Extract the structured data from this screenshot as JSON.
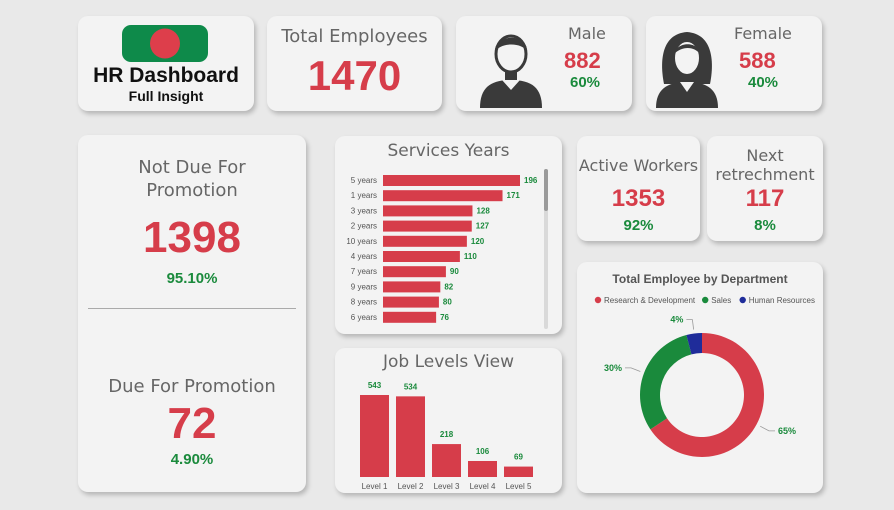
{
  "brand": {
    "title": "HR Dashboard",
    "subtitle": "Full Insight",
    "flag_colors": {
      "field": "#0e8a4a",
      "disc": "#dd3e4b"
    }
  },
  "total_employees": {
    "label": "Total Employees",
    "value": "1470"
  },
  "male": {
    "label": "Male",
    "value": "882",
    "percent": "60%",
    "icon": "male-person-icon"
  },
  "female": {
    "label": "Female",
    "value": "588",
    "percent": "40%",
    "icon": "female-person-icon"
  },
  "promotion": {
    "not_due_label_line1": "Not Due For",
    "not_due_label_line2": "Promotion",
    "not_due_value": "1398",
    "not_due_percent": "95.10%",
    "due_label": "Due For Promotion",
    "due_value": "72",
    "due_percent": "4.90%"
  },
  "active_workers": {
    "label": "Active Workers",
    "value": "1353",
    "percent": "92%"
  },
  "next_retrenchment": {
    "label_line1": "Next",
    "label_line2": "retrechment",
    "value": "117",
    "percent": "8%"
  },
  "colors": {
    "accent_red": "#d63d4a",
    "accent_green": "#1a8a3c",
    "hr_blue": "#1f2c9a"
  },
  "chart_data": [
    {
      "type": "bar",
      "orientation": "horizontal",
      "title": "Services Years",
      "categories": [
        "5 years",
        "1 years",
        "3 years",
        "2 years",
        "10 years",
        "4 years",
        "7 years",
        "9 years",
        "8 years",
        "6 years"
      ],
      "values": [
        196,
        171,
        128,
        127,
        120,
        110,
        90,
        82,
        80,
        76
      ],
      "data_labels": true,
      "scrollbar": true
    },
    {
      "type": "bar",
      "title": "Job Levels View",
      "categories": [
        "Level 1",
        "Level 2",
        "Level 3",
        "Level 4",
        "Level 5"
      ],
      "values": [
        543,
        534,
        218,
        106,
        69
      ],
      "data_labels": true
    },
    {
      "type": "pie",
      "variant": "donut",
      "title": "Total Employee by Department",
      "legend_position": "top",
      "series": [
        {
          "name": "Research & Development",
          "value": 65,
          "label": "65%",
          "color": "#d63d4a"
        },
        {
          "name": "Sales",
          "value": 30,
          "label": "30%",
          "color": "#1a8a3c"
        },
        {
          "name": "Human Resources",
          "value": 4,
          "label": "4%",
          "color": "#1f2c9a"
        }
      ]
    }
  ]
}
